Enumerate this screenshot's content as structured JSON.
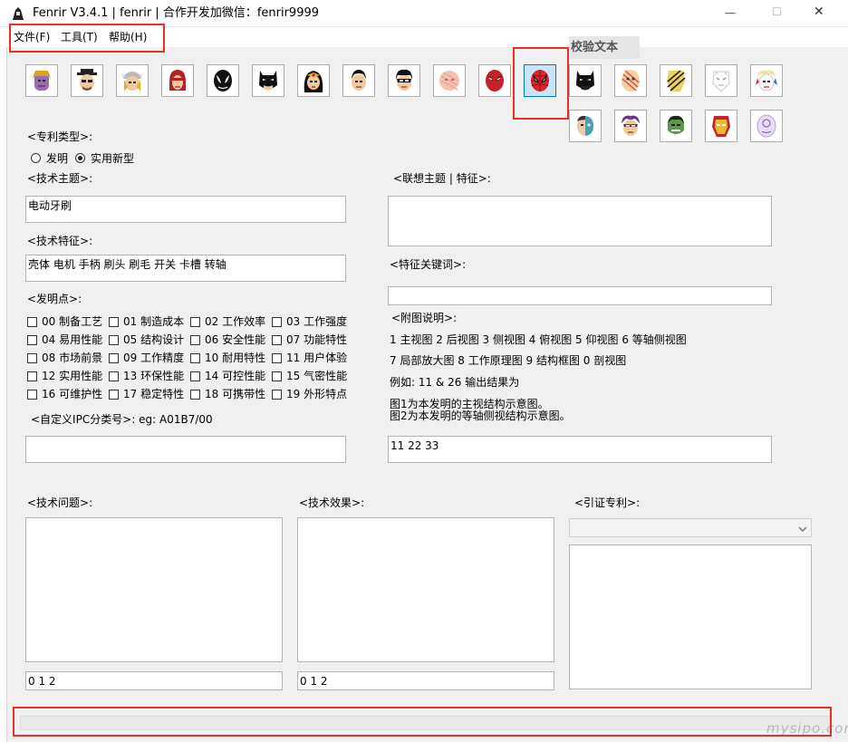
{
  "window": {
    "title": "Fenrir V3.4.1 | fenrir | 合作开发加微信：fenrir9999",
    "minimize": "—",
    "maximize": "☐",
    "close": "✕"
  },
  "menu": {
    "file": "文件(F)",
    "tools": "工具(T)",
    "help": "帮助(H)"
  },
  "tab": {
    "label": "校验文本"
  },
  "heroes": [
    "thanos",
    "heisenberg",
    "thor",
    "magneto",
    "venom",
    "batman",
    "wonder-woman",
    "superman",
    "robin",
    "blossom",
    "deadpool",
    "spider-man",
    "batman-dark",
    "striped",
    "ironman-mono",
    "white-face",
    "harley",
    "two-face",
    "hawkeye",
    "hulk",
    "iron-man",
    "purple-face"
  ],
  "patent_type": {
    "label": "<专利类型>:",
    "options": [
      "发明",
      "实用新型"
    ],
    "selected": "实用新型"
  },
  "tech_topic": {
    "label": "<技术主题>:",
    "value": "电动牙刷"
  },
  "tech_features": {
    "label": "<技术特征>:",
    "value": "壳体 电机 手柄 刷头 刷毛 开关 卡槽 转轴"
  },
  "invention_points": {
    "label": "<发明点>:",
    "items": [
      "00 制备工艺",
      "01 制造成本",
      "02 工作效率",
      "03 工作强度",
      "04 易用性能",
      "05 结构设计",
      "06 安全性能",
      "07 功能特性",
      "08 市场前景",
      "09 工作精度",
      "10 耐用特性",
      "11 用户体验",
      "12 实用性能",
      "13 环保性能",
      "14 可控性能",
      "15 气密性能",
      "16 可维护性",
      "17 稳定特性",
      "18 可携带性",
      "19 外形特点"
    ]
  },
  "ipc": {
    "label": "<自定义IPC分类号>:   eg: A01B7/00",
    "value": ""
  },
  "assoc_topic": {
    "label": "<联想主题 | 特征>:",
    "value": ""
  },
  "feature_keywords": {
    "label": "<特征关键词>:",
    "value": ""
  },
  "figures": {
    "label": "<附图说明>:",
    "line1": "1 主视图 2 后视图 3 侧视图 4 俯视图 5 仰视图 6 等轴侧视图",
    "line2": "7 局部放大图 8 工作原理图 9 结构框图 0 剖视图",
    "example": "例如: 11 & 26 输出结果为",
    "result1": "图1为本发明的主视结构示意图。",
    "result2": "图2为本发明的等轴侧视结构示意图。",
    "value": "11 22 33"
  },
  "tech_problem": {
    "label": "<技术问题>:",
    "value": "",
    "seq": "0 1 2"
  },
  "tech_effect": {
    "label": "<技术效果>:",
    "value": "",
    "seq": "0 1 2"
  },
  "cited_patent": {
    "label": "<引证专利>:",
    "value": ""
  },
  "watermark": "mysipo.com",
  "colors": {
    "highlight": "#e8302a",
    "selected_bg": "#cce4f7"
  }
}
